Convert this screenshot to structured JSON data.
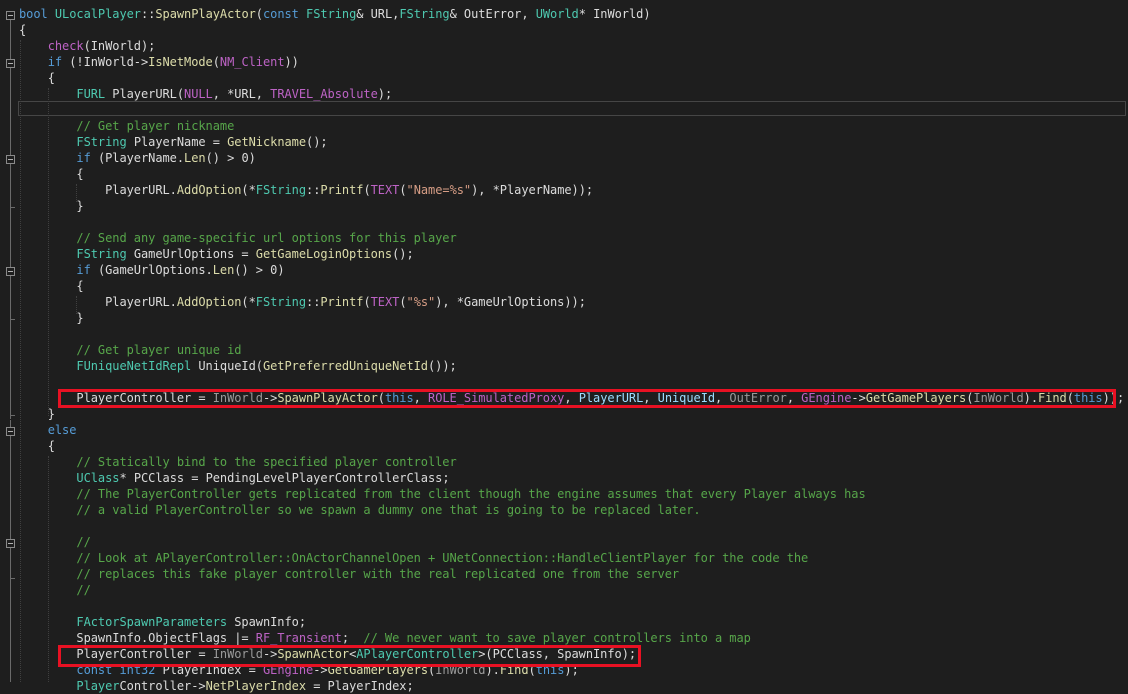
{
  "editor": {
    "lines": [
      {
        "y": 0,
        "tokens": [
          [
            "kw",
            "bool "
          ],
          [
            "ty",
            "ULocalPlayer"
          ],
          [
            "def",
            "::"
          ],
          [
            "fn",
            "SpawnPlayActor"
          ],
          [
            "def",
            "("
          ],
          [
            "kw",
            "const "
          ],
          [
            "ty",
            "FString"
          ],
          [
            "def",
            "& URL,"
          ],
          [
            "ty",
            "FString"
          ],
          [
            "def",
            "& OutError, "
          ],
          [
            "ty",
            "UWorld"
          ],
          [
            "def",
            "* InWorld)"
          ]
        ]
      },
      {
        "y": 1,
        "tokens": [
          [
            "def",
            "{"
          ]
        ]
      },
      {
        "y": 2,
        "tokens": [
          [
            "def",
            "    "
          ],
          [
            "mac",
            "check"
          ],
          [
            "def",
            "(InWorld);"
          ]
        ]
      },
      {
        "y": 3,
        "tokens": [
          [
            "def",
            "    "
          ],
          [
            "kw",
            "if "
          ],
          [
            "def",
            "(!InWorld->"
          ],
          [
            "fn",
            "IsNetMode"
          ],
          [
            "def",
            "("
          ],
          [
            "mac",
            "NM_Client"
          ],
          [
            "def",
            "))"
          ]
        ]
      },
      {
        "y": 4,
        "tokens": [
          [
            "def",
            "    {"
          ]
        ]
      },
      {
        "y": 5,
        "tokens": [
          [
            "def",
            "        "
          ],
          [
            "ty",
            "FURL "
          ],
          [
            "def",
            "PlayerURL("
          ],
          [
            "mac",
            "NULL"
          ],
          [
            "def",
            ", *URL, "
          ],
          [
            "mac",
            "TRAVEL_Absolute"
          ],
          [
            "def",
            ");"
          ]
        ]
      },
      {
        "y": 6,
        "tokens": []
      },
      {
        "y": 7,
        "tokens": [
          [
            "def",
            "        "
          ],
          [
            "cmt",
            "// Get player nickname"
          ]
        ]
      },
      {
        "y": 8,
        "tokens": [
          [
            "def",
            "        "
          ],
          [
            "ty",
            "FString "
          ],
          [
            "def",
            "PlayerName = "
          ],
          [
            "fn",
            "GetNickname"
          ],
          [
            "def",
            "();"
          ]
        ]
      },
      {
        "y": 9,
        "tokens": [
          [
            "def",
            "        "
          ],
          [
            "kw",
            "if "
          ],
          [
            "def",
            "(PlayerName."
          ],
          [
            "fn",
            "Len"
          ],
          [
            "def",
            "() > 0)"
          ]
        ]
      },
      {
        "y": 10,
        "tokens": [
          [
            "def",
            "        {"
          ]
        ]
      },
      {
        "y": 11,
        "tokens": [
          [
            "def",
            "            PlayerURL."
          ],
          [
            "fn",
            "AddOption"
          ],
          [
            "def",
            "(*"
          ],
          [
            "ty",
            "FString"
          ],
          [
            "def",
            "::"
          ],
          [
            "fn",
            "Printf"
          ],
          [
            "def",
            "("
          ],
          [
            "mac",
            "TEXT"
          ],
          [
            "def",
            "("
          ],
          [
            "str",
            "\"Name=%s\""
          ],
          [
            "def",
            "), *PlayerName));"
          ]
        ]
      },
      {
        "y": 12,
        "tokens": [
          [
            "def",
            "        }"
          ]
        ]
      },
      {
        "y": 13,
        "tokens": []
      },
      {
        "y": 14,
        "tokens": [
          [
            "def",
            "        "
          ],
          [
            "cmt",
            "// Send any game-specific url options for this player"
          ]
        ]
      },
      {
        "y": 15,
        "tokens": [
          [
            "def",
            "        "
          ],
          [
            "ty",
            "FString "
          ],
          [
            "def",
            "GameUrlOptions = "
          ],
          [
            "fn",
            "GetGameLoginOptions"
          ],
          [
            "def",
            "();"
          ]
        ]
      },
      {
        "y": 16,
        "tokens": [
          [
            "def",
            "        "
          ],
          [
            "kw",
            "if "
          ],
          [
            "def",
            "(GameUrlOptions."
          ],
          [
            "fn",
            "Len"
          ],
          [
            "def",
            "() > 0)"
          ]
        ]
      },
      {
        "y": 17,
        "tokens": [
          [
            "def",
            "        {"
          ]
        ]
      },
      {
        "y": 18,
        "tokens": [
          [
            "def",
            "            PlayerURL."
          ],
          [
            "fn",
            "AddOption"
          ],
          [
            "def",
            "(*"
          ],
          [
            "ty",
            "FString"
          ],
          [
            "def",
            "::"
          ],
          [
            "fn",
            "Printf"
          ],
          [
            "def",
            "("
          ],
          [
            "mac",
            "TEXT"
          ],
          [
            "def",
            "("
          ],
          [
            "str",
            "\"%s\""
          ],
          [
            "def",
            "), *GameUrlOptions));"
          ]
        ]
      },
      {
        "y": 19,
        "tokens": [
          [
            "def",
            "        }"
          ]
        ]
      },
      {
        "y": 20,
        "tokens": []
      },
      {
        "y": 21,
        "tokens": [
          [
            "def",
            "        "
          ],
          [
            "cmt",
            "// Get player unique id"
          ]
        ]
      },
      {
        "y": 22,
        "tokens": [
          [
            "def",
            "        "
          ],
          [
            "ty",
            "FUniqueNetIdRepl "
          ],
          [
            "def",
            "UniqueId("
          ],
          [
            "fn",
            "GetPreferredUniqueNetId"
          ],
          [
            "def",
            "());"
          ]
        ]
      },
      {
        "y": 23,
        "tokens": []
      },
      {
        "y": 24,
        "tokens": [
          [
            "def",
            "        PlayerController = "
          ],
          [
            "par",
            "InWorld"
          ],
          [
            "def",
            "->"
          ],
          [
            "fn",
            "SpawnPlayActor"
          ],
          [
            "def",
            "("
          ],
          [
            "kw",
            "this"
          ],
          [
            "def",
            ", "
          ],
          [
            "mac",
            "ROLE_SimulatedProxy"
          ],
          [
            "def",
            ", "
          ],
          [
            "pnm",
            "PlayerURL"
          ],
          [
            "def",
            ", "
          ],
          [
            "pnm",
            "UniqueId"
          ],
          [
            "def",
            ", "
          ],
          [
            "par",
            "OutError"
          ],
          [
            "def",
            ", "
          ],
          [
            "mac",
            "GEngine"
          ],
          [
            "def",
            "->"
          ],
          [
            "fn",
            "GetGamePlayers"
          ],
          [
            "def",
            "("
          ],
          [
            "par",
            "InWorld"
          ],
          [
            "def",
            ")."
          ],
          [
            "fn",
            "Find"
          ],
          [
            "def",
            "("
          ],
          [
            "kw",
            "this"
          ],
          [
            "def",
            "));"
          ]
        ]
      },
      {
        "y": 25,
        "tokens": [
          [
            "def",
            "    }"
          ]
        ]
      },
      {
        "y": 26,
        "tokens": [
          [
            "def",
            "    "
          ],
          [
            "kw",
            "else"
          ]
        ]
      },
      {
        "y": 27,
        "tokens": [
          [
            "def",
            "    {"
          ]
        ]
      },
      {
        "y": 28,
        "tokens": [
          [
            "def",
            "        "
          ],
          [
            "cmt",
            "// Statically bind to the specified player controller"
          ]
        ]
      },
      {
        "y": 29,
        "tokens": [
          [
            "def",
            "        "
          ],
          [
            "ty",
            "UClass"
          ],
          [
            "def",
            "* PCClass = PendingLevelPlayerControllerClass;"
          ]
        ]
      },
      {
        "y": 30,
        "tokens": [
          [
            "def",
            "        "
          ],
          [
            "cmt",
            "// The PlayerController gets replicated from the client though the engine assumes that every Player always has"
          ]
        ]
      },
      {
        "y": 31,
        "tokens": [
          [
            "def",
            "        "
          ],
          [
            "cmt",
            "// a valid PlayerController so we spawn a dummy one that is going to be replaced later."
          ]
        ]
      },
      {
        "y": 32,
        "tokens": []
      },
      {
        "y": 33,
        "tokens": [
          [
            "def",
            "        "
          ],
          [
            "cmt",
            "//"
          ]
        ]
      },
      {
        "y": 34,
        "tokens": [
          [
            "def",
            "        "
          ],
          [
            "cmt",
            "// Look at APlayerController::OnActorChannelOpen + UNetConnection::HandleClientPlayer for the code the"
          ]
        ]
      },
      {
        "y": 35,
        "tokens": [
          [
            "def",
            "        "
          ],
          [
            "cmt",
            "// replaces this fake player controller with the real replicated one from the server"
          ]
        ]
      },
      {
        "y": 36,
        "tokens": [
          [
            "def",
            "        "
          ],
          [
            "cmt",
            "//"
          ]
        ]
      },
      {
        "y": 37,
        "tokens": []
      },
      {
        "y": 38,
        "tokens": [
          [
            "def",
            "        "
          ],
          [
            "ty",
            "FActorSpawnParameters "
          ],
          [
            "def",
            "SpawnInfo;"
          ]
        ]
      },
      {
        "y": 39,
        "tokens": [
          [
            "def",
            "        SpawnInfo.ObjectFlags |= "
          ],
          [
            "mac",
            "RF_Transient"
          ],
          [
            "def",
            ";  "
          ],
          [
            "cmt",
            "// We never want to save player controllers into a map"
          ]
        ]
      },
      {
        "y": 40,
        "tokens": [
          [
            "def",
            "        PlayerController = "
          ],
          [
            "par",
            "InWorld"
          ],
          [
            "def",
            "->"
          ],
          [
            "fn",
            "SpawnActor"
          ],
          [
            "def",
            "<"
          ],
          [
            "ty",
            "APlayerController"
          ],
          [
            "def",
            ">(PCClass, SpawnInfo);"
          ]
        ]
      },
      {
        "y": 41,
        "tokens": [
          [
            "def",
            "        "
          ],
          [
            "kw",
            "const "
          ],
          [
            "kw",
            "int32 "
          ],
          [
            "def",
            "PlayerIndex = "
          ],
          [
            "mac",
            "GEngine"
          ],
          [
            "def",
            "->"
          ],
          [
            "fn",
            "GetGamePlayers"
          ],
          [
            "def",
            "("
          ],
          [
            "par",
            "InWorld"
          ],
          [
            "def",
            ")."
          ],
          [
            "fn",
            "Find"
          ],
          [
            "def",
            "("
          ],
          [
            "kw",
            "this"
          ],
          [
            "def",
            ");"
          ]
        ]
      },
      {
        "y": 42,
        "tokens": [
          [
            "def",
            "        "
          ],
          [
            "ty",
            "Player"
          ],
          [
            "def",
            "Controller"
          ],
          [
            "def",
            "->"
          ],
          [
            "fn",
            "NetPlayerIndex"
          ],
          [
            "def",
            " = PlayerIndex;"
          ]
        ]
      }
    ],
    "colors": {
      "background": "#1e1e1e",
      "keyword": "#569cd6",
      "function": "#dcdcaa",
      "type": "#4ec9b0",
      "comment": "#57a64a",
      "string": "#d69d85",
      "macro": "#bd63c5",
      "highlight_box": "#e81123"
    }
  }
}
